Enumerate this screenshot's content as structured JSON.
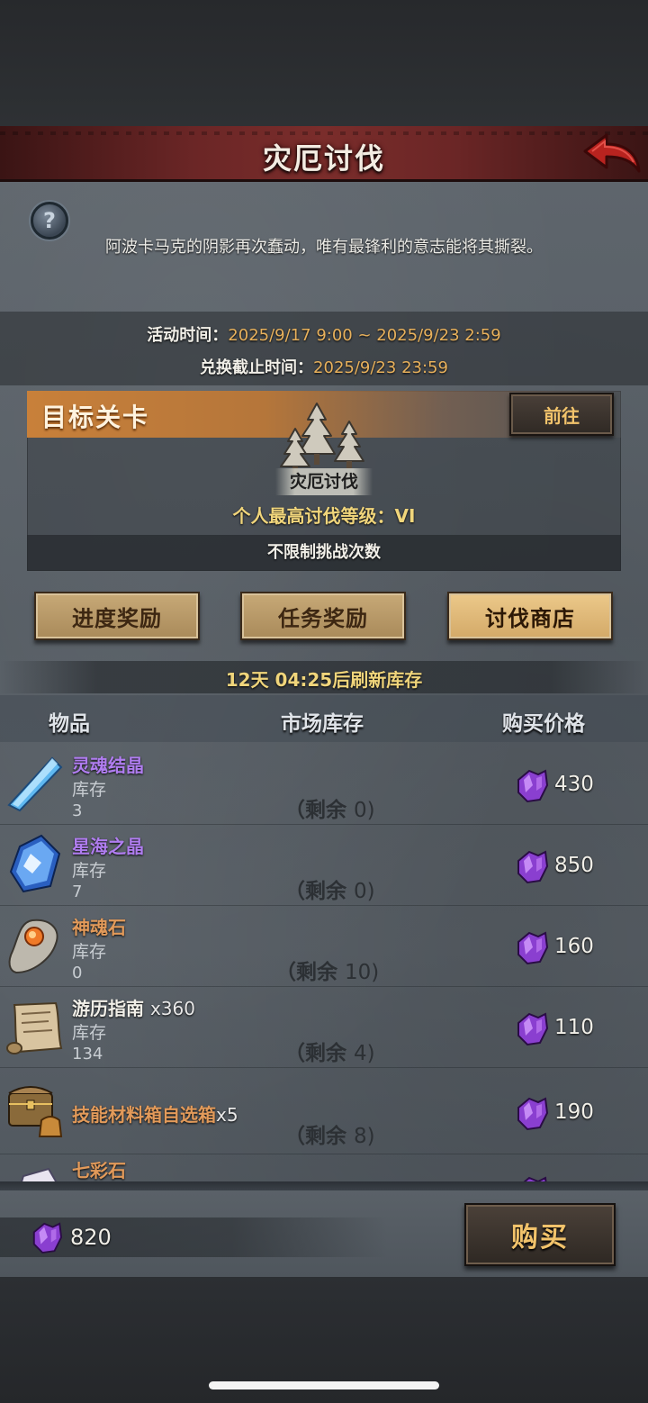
{
  "header": {
    "title": "灾厄讨伐"
  },
  "intro": {
    "text": "阿波卡马克的阴影再次蠢动，唯有最锋利的意志能将其撕裂。"
  },
  "event_time": {
    "label": "活动时间：",
    "value": "2025/9/17 9:00 ~ 2025/9/23 2:59",
    "deadline_label": "兑换截止时间：",
    "deadline_value": "2025/9/23 23:59"
  },
  "stage": {
    "header": "目标关卡",
    "goto_label": "前往",
    "name": "灾厄讨伐",
    "best_level": "个人最高讨伐等级：VI",
    "challenge_text": "不限制挑战次数"
  },
  "tabs": [
    {
      "label": "进度奖励",
      "active": false
    },
    {
      "label": "任务奖励",
      "active": false
    },
    {
      "label": "讨伐商店",
      "active": true
    }
  ],
  "refresh_text": "12天 04:25后刷新库存",
  "table": {
    "headers": {
      "item": "物品",
      "stock": "市场库存",
      "price": "购买价格"
    },
    "rows": [
      {
        "name": "灵魂结晶",
        "qty": "",
        "color": "#b07df0",
        "icon": "blue-crystal-icon",
        "stock_label": "库存",
        "stock_value": "3",
        "remain_label": "（剩余",
        "remain_value": "0)",
        "price": "430"
      },
      {
        "name": "星海之晶",
        "qty": "",
        "color": "#b07df0",
        "icon": "star-sea-crystal-icon",
        "stock_label": "库存",
        "stock_value": "7",
        "remain_label": "（剩余",
        "remain_value": "0)",
        "price": "850"
      },
      {
        "name": "神魂石",
        "qty": "",
        "color": "#e29a5a",
        "icon": "soul-stone-icon",
        "stock_label": "库存",
        "stock_value": "0",
        "remain_label": "（剩余",
        "remain_value": "10)",
        "price": "160"
      },
      {
        "name": "游历指南",
        "qty": "x360",
        "color": "#f1efe8",
        "icon": "scroll-icon",
        "stock_label": "库存",
        "stock_value": "134",
        "remain_label": "（剩余",
        "remain_value": "4)",
        "price": "110"
      },
      {
        "name": "技能材料箱自选箱",
        "qty": "x5",
        "color": "#e29a5a",
        "icon": "treasure-chest-icon",
        "stock_label": "",
        "stock_value": "",
        "remain_label": "（剩余",
        "remain_value": "8)",
        "price": "190"
      },
      {
        "name": "七彩石",
        "qty": "",
        "color": "#e29a5a",
        "icon": "rainbow-stone-icon",
        "stock_label": "",
        "stock_value": "",
        "remain_label": "",
        "remain_value": "",
        "price": ""
      }
    ]
  },
  "footer": {
    "balance": "820",
    "buy_label": "购买"
  }
}
